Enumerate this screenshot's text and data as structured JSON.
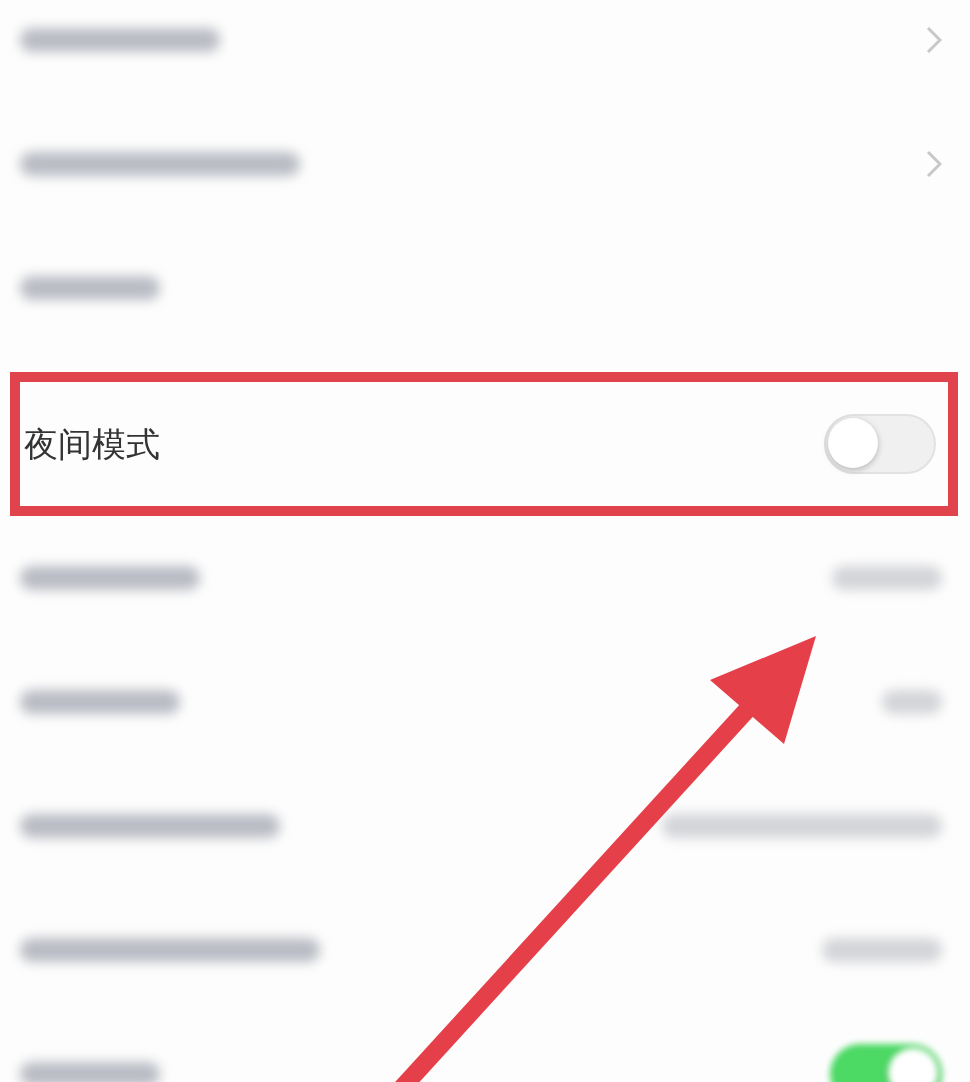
{
  "rows": [
    {
      "kind": "blurred",
      "trailing": {
        "kind": "chevron"
      }
    },
    {
      "kind": "blurred",
      "trailing": {
        "kind": "chevron"
      }
    },
    {
      "kind": "blurred"
    },
    {
      "kind": "setting",
      "label": "夜间模式",
      "on": false,
      "highlighted": true
    },
    {
      "kind": "blurred",
      "trailing": {
        "kind": "value"
      }
    },
    {
      "kind": "blurred",
      "trailing": {
        "kind": "value"
      }
    },
    {
      "kind": "blurred",
      "trailing": {
        "kind": "value"
      }
    },
    {
      "kind": "blurred",
      "trailing": {
        "kind": "value"
      }
    },
    {
      "kind": "blurred",
      "trailing": {
        "kind": "toggle",
        "on": true
      }
    }
  ],
  "annotations": [
    {
      "kind": "arrow"
    }
  ]
}
